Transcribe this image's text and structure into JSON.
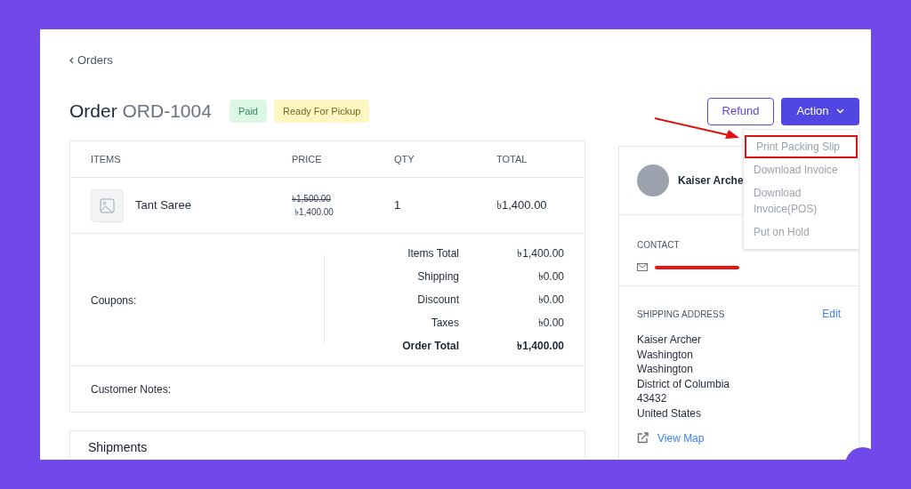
{
  "back_link": "Orders",
  "order": {
    "label": "Order",
    "number": "ORD-1004"
  },
  "badges": [
    {
      "label": "Paid",
      "color": "#dcf7e3"
    },
    {
      "label": "Ready For Pickup",
      "color": "#fdf6c3"
    }
  ],
  "buttons": [
    {
      "label": "Refund",
      "kind": "outline"
    },
    {
      "label": "Action",
      "kind": "solid"
    }
  ],
  "action_menu": [
    {
      "label": "Print Packing Slip",
      "highlighted": true
    },
    {
      "label": "Download Invoice",
      "highlighted": false
    },
    {
      "label": "Download Invoice(POS)",
      "highlighted": false
    },
    {
      "label": "Put on Hold",
      "highlighted": false
    }
  ],
  "items_table": {
    "columns": [
      "ITEMS",
      "PRICE",
      "QTY",
      "TOTAL"
    ],
    "rows": [
      {
        "name": "Tant Saree",
        "old_price": "৳1,500.00",
        "price": "৳1,400.00",
        "qty": "1",
        "total": "৳1,400.00"
      }
    ]
  },
  "coupons_label": "Coupons:",
  "totals": [
    {
      "label": "Items Total",
      "value": "৳1,400.00",
      "bold": false
    },
    {
      "label": "Shipping",
      "value": "৳0.00",
      "bold": false
    },
    {
      "label": "Discount",
      "value": "৳0.00",
      "bold": false
    },
    {
      "label": "Taxes",
      "value": "৳0.00",
      "bold": false
    },
    {
      "label": "Order Total",
      "value": "৳1,400.00",
      "bold": true
    }
  ],
  "customer_notes_label": "Customer Notes:",
  "shipments_title": "Shipments",
  "customer": {
    "name": "Kaiser Arche"
  },
  "contact": {
    "heading": "CONTACT"
  },
  "shipping_address": {
    "heading": "SHIPPING ADDRESS",
    "edit": "Edit",
    "lines": [
      "Kaiser Archer",
      "Washington",
      "Washington",
      "District of Columbia",
      "43432",
      "United States"
    ],
    "map_link": "View Map"
  }
}
